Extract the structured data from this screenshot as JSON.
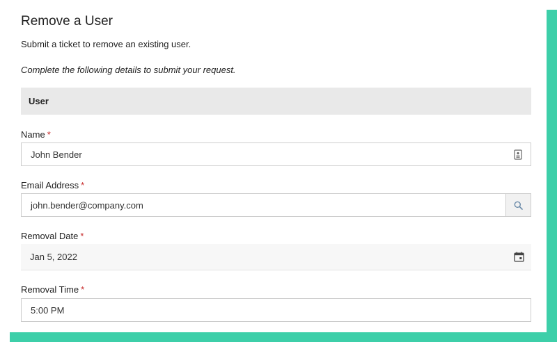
{
  "form": {
    "title": "Remove a User",
    "subtitle": "Submit a ticket to remove an existing user.",
    "instructions": "Complete the following details to submit your request.",
    "section_header": "User",
    "required_marker": "*"
  },
  "fields": {
    "name": {
      "label": "Name",
      "value": "John Bender",
      "icon": "contact-card-icon"
    },
    "email": {
      "label": "Email Address",
      "value": "john.bender@company.com",
      "icon": "search-icon"
    },
    "removal_date": {
      "label": "Removal Date",
      "value": "Jan 5, 2022",
      "icon": "calendar-icon"
    },
    "removal_time": {
      "label": "Removal Time",
      "value": "5:00 PM"
    }
  },
  "colors": {
    "accent": "#3dcfa9",
    "required": "#c62828",
    "section_bg": "#e9e9e9"
  }
}
